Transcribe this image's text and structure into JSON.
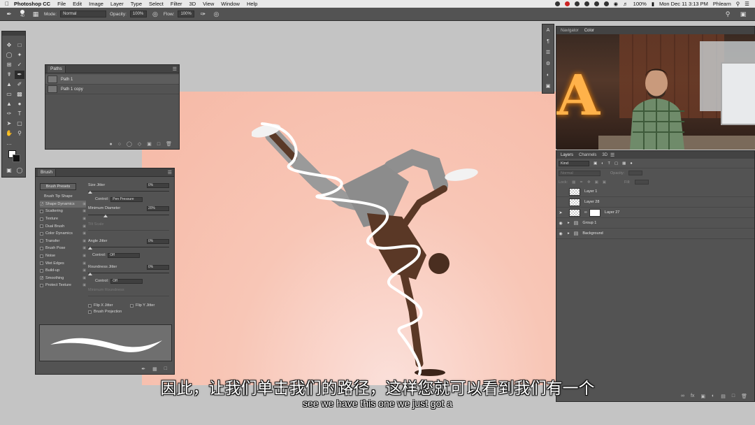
{
  "menubar": {
    "app_name": "Photoshop CC",
    "menus": [
      "File",
      "Edit",
      "Image",
      "Layer",
      "Type",
      "Select",
      "Filter",
      "3D",
      "View",
      "Window",
      "Help"
    ],
    "clock": "Mon Dec 11  3:13 PM",
    "user": "Phlearn",
    "battery": "100%"
  },
  "options_bar": {
    "brush_size": "40",
    "mode_label": "Mode:",
    "mode_value": "Normal",
    "opacity_label": "Opacity:",
    "opacity_value": "100%",
    "flow_label": "Flow:",
    "flow_value": "100%"
  },
  "paths_panel": {
    "tab": "Paths",
    "paths": [
      {
        "name": "Path 1",
        "selected": true
      },
      {
        "name": "Path 1 copy",
        "selected": false
      }
    ]
  },
  "brush_panel": {
    "tab": "Brush",
    "presets_button": "Brush Presets",
    "tip_shape": "Brush Tip Shape",
    "options": [
      {
        "label": "Shape Dynamics",
        "checked": true,
        "selected": true
      },
      {
        "label": "Scattering",
        "checked": false,
        "selected": false
      },
      {
        "label": "Texture",
        "checked": false,
        "selected": false
      },
      {
        "label": "Dual Brush",
        "checked": false,
        "selected": false
      },
      {
        "label": "Color Dynamics",
        "checked": false,
        "selected": false
      },
      {
        "label": "Transfer",
        "checked": false,
        "selected": false
      },
      {
        "label": "Brush Pose",
        "checked": false,
        "selected": false
      },
      {
        "label": "Noise",
        "checked": false,
        "selected": false
      },
      {
        "label": "Wet Edges",
        "checked": false,
        "selected": false
      },
      {
        "label": "Build-up",
        "checked": false,
        "selected": false
      },
      {
        "label": "Smoothing",
        "checked": true,
        "selected": false
      },
      {
        "label": "Protect Texture",
        "checked": false,
        "selected": false
      }
    ],
    "settings": {
      "size_jitter_label": "Size Jitter",
      "size_jitter_value": "0%",
      "control_label": "Control:",
      "size_control": "Pen Pressure",
      "min_diameter_label": "Minimum Diameter",
      "min_diameter_value": "20%",
      "tilt_scale_label": "Tilt Scale",
      "angle_jitter_label": "Angle Jitter",
      "angle_jitter_value": "0%",
      "angle_control": "Off",
      "roundness_jitter_label": "Roundness Jitter",
      "roundness_jitter_value": "0%",
      "roundness_control": "Off",
      "min_roundness_label": "Minimum Roundness",
      "flip_x": "Flip X Jitter",
      "flip_y": "Flip Y Jitter",
      "projection": "Brush Projection"
    }
  },
  "navigator_panel": {
    "tabs": [
      "Navigator",
      "Color"
    ]
  },
  "layers_panel": {
    "tabs": [
      "Layers",
      "Channels",
      "3D"
    ],
    "filter_kind": "Kind",
    "blend_mode": "Normal",
    "opacity_label": "Opacity:",
    "lock_label": "Lock:",
    "fill_label": "Fill:",
    "layers": [
      {
        "name": "Layer 1",
        "type": "layer",
        "visible": false
      },
      {
        "name": "Layer 28",
        "type": "layer",
        "visible": false
      },
      {
        "name": "Layer 27",
        "type": "layer-mask",
        "visible": false
      },
      {
        "name": "Group 1",
        "type": "group",
        "visible": true
      },
      {
        "name": "Background",
        "type": "group",
        "visible": true
      }
    ]
  },
  "subtitles": {
    "chinese": "因此，让我们单击我们的路径，这样您就可以看到我们有一个",
    "english": "see we have this one we just got a"
  }
}
